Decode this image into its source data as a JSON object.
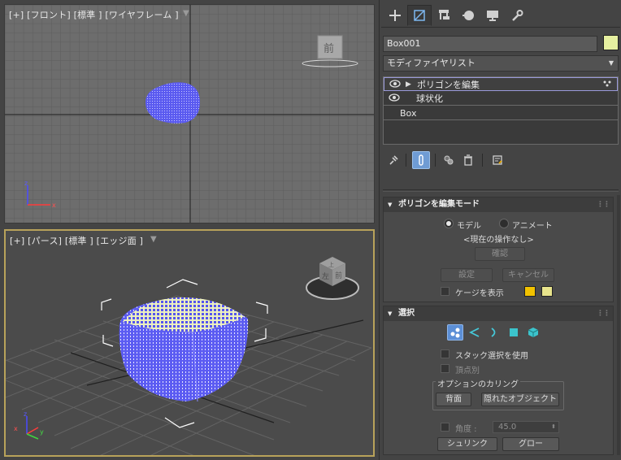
{
  "viewports": {
    "front": {
      "label": "[+] [フロント] [標準 ] [ワイヤフレーム ]",
      "cube_label": "前"
    },
    "perspective": {
      "label": "[+] [パース] [標準 ] [エッジ面 ]",
      "cube_front": "前",
      "cube_left": "左",
      "cube_top": "上"
    }
  },
  "axes": {
    "x": "x",
    "y": "y",
    "z": "z"
  },
  "command_panel": {
    "tabs": [
      "create-icon",
      "modify-icon",
      "hierarchy-icon",
      "motion-icon",
      "display-icon",
      "utilities-icon"
    ],
    "object_name": "Box001",
    "object_color": "#e6f0a0",
    "modifier_list": "モディファイヤリスト",
    "stack": [
      {
        "label": "ポリゴンを編集",
        "visible": true,
        "expandable": true,
        "selected": true
      },
      {
        "label": "球状化",
        "visible": true,
        "expandable": false,
        "selected": false
      },
      {
        "label": "Box",
        "visible": false,
        "expandable": false,
        "selected": false
      }
    ]
  },
  "edit_poly_mode": {
    "title": "ポリゴンを編集モード",
    "model_label": "モデル",
    "animate_label": "アニメート",
    "current_operation": "<現在の操作なし>",
    "commit_label": "確認",
    "settings_label": "設定",
    "cancel_label": "キャンセル",
    "show_cage_label": "ケージを表示",
    "cage_color_1": "#f2c200",
    "cage_color_2": "#e8e48c"
  },
  "selection": {
    "title": "選択",
    "icons": [
      "vertex-icon",
      "edge-icon",
      "border-icon",
      "polygon-icon",
      "element-icon"
    ],
    "use_stack_selection": "スタック選択を使用",
    "by_vertex": "頂点別",
    "culling_group": "オプションのカリング",
    "backface_label": "背面",
    "occluded_label": "隠れたオブジェクト",
    "angle_label": "角度 :",
    "angle_value": "45.0",
    "shrink_label": "シュリンク",
    "grow_label": "グロー"
  }
}
